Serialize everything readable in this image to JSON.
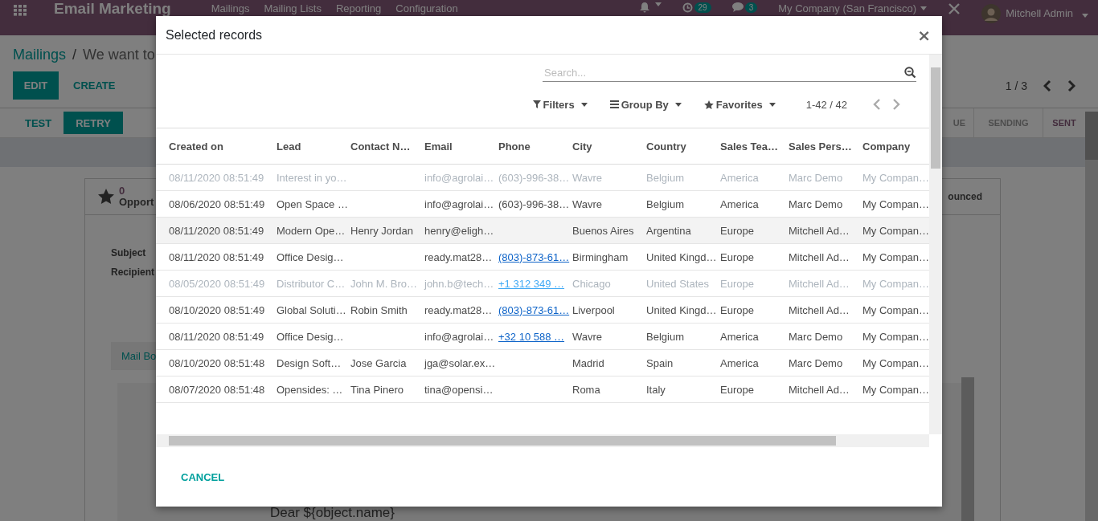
{
  "app": {
    "navbar": {
      "app_name": "Email Marketing",
      "menu": [
        "Mailings",
        "Mailing Lists",
        "Reporting",
        "Configuration"
      ],
      "activity_badge": "29",
      "message_badge": "3",
      "company": "My Company (San Francisco)",
      "user": "Mitchell Admin"
    },
    "breadcrumb": {
      "root": "Mailings",
      "separator": "/",
      "current": "We want to"
    },
    "buttons": [
      "EDIT",
      "CREATE"
    ],
    "pager": "1 / 3",
    "actions": [
      {
        "label": "TEST",
        "primary": false
      },
      {
        "label": "RETRY",
        "primary": true
      }
    ],
    "stages": [
      {
        "label": "UE",
        "selected": false
      },
      {
        "label": "SENDING",
        "selected": false
      },
      {
        "label": "SENT",
        "selected": true
      }
    ],
    "stats": [
      {
        "value": "0",
        "label": "Opport"
      },
      {
        "label": "ounced"
      }
    ],
    "fields": [
      "Subject",
      "Recipient"
    ],
    "tab": "Mail Bo",
    "body_text": "Dear ${object.name}"
  },
  "dialog": {
    "title": "Selected records",
    "close": "×",
    "search": {
      "placeholder": "Search..."
    },
    "filters": [
      {
        "label": "Filters",
        "kind": "filter"
      },
      {
        "label": "Group By",
        "kind": "group"
      },
      {
        "label": "Favorites",
        "kind": "favorite"
      }
    ],
    "pager": "1-42 / 42",
    "columns": [
      "Created on",
      "Lead",
      "Contact N…",
      "Email",
      "Phone",
      "City",
      "Country",
      "Sales Tea…",
      "Sales Pers…",
      "Company"
    ],
    "rows": [
      {
        "muted": true,
        "highlighted": false,
        "cells": [
          "08/11/2020 08:51:49",
          "Interest in yo…",
          "",
          "info@agrolai…",
          "(603)-996-38…",
          "Wavre",
          "Belgium",
          "America",
          "Marc Demo",
          "My Compan…"
        ]
      },
      {
        "muted": false,
        "highlighted": false,
        "cells": [
          "08/06/2020 08:51:49",
          "Open Space …",
          "",
          "info@agrolai…",
          "(603)-996-38…",
          "Wavre",
          "Belgium",
          "America",
          "Marc Demo",
          "My Compan…"
        ]
      },
      {
        "muted": false,
        "highlighted": true,
        "cells": [
          "08/11/2020 08:51:49",
          "Modern Ope…",
          "Henry Jordan",
          "henry@eligh…",
          "",
          "Buenos Aires",
          "Argentina",
          "Europe",
          "Mitchell Ad…",
          "My Compan…"
        ]
      },
      {
        "muted": false,
        "highlighted": false,
        "cells": [
          "08/11/2020 08:51:49",
          "Office Desig…",
          "",
          "ready.mat28…",
          {
            "text": "(803)-873-61…",
            "kind": "link"
          },
          "Birmingham",
          "United Kingd…",
          "Europe",
          "Mitchell Ad…",
          "My Compan…"
        ]
      },
      {
        "muted": true,
        "highlighted": false,
        "cells": [
          "08/05/2020 08:51:49",
          "Distributor C…",
          "John M. Bro…",
          "john.b@tech…",
          {
            "text": "+1 312 349 …",
            "kind": "link"
          },
          "Chicago",
          "United States",
          "Europe",
          "Mitchell Ad…",
          "My Compan…"
        ]
      },
      {
        "muted": false,
        "highlighted": false,
        "cells": [
          "08/10/2020 08:51:49",
          "Global Soluti…",
          "Robin Smith",
          "ready.mat28…",
          {
            "text": "(803)-873-61…",
            "kind": "link"
          },
          "Liverpool",
          "United Kingd…",
          "Europe",
          "Mitchell Ad…",
          "My Compan…"
        ]
      },
      {
        "muted": false,
        "highlighted": false,
        "cells": [
          "08/11/2020 08:51:49",
          "Office Desig…",
          "",
          "info@agrolai…",
          {
            "text": "+32 10 588 …",
            "kind": "link"
          },
          "Wavre",
          "Belgium",
          "America",
          "Marc Demo",
          "My Compan…"
        ]
      },
      {
        "muted": false,
        "highlighted": false,
        "cells": [
          "08/10/2020 08:51:48",
          "Design Soft…",
          "Jose Garcia",
          "jga@solar.ex…",
          "",
          "Madrid",
          "Spain",
          "America",
          "Marc Demo",
          "My Compan…"
        ]
      },
      {
        "muted": false,
        "highlighted": false,
        "cells": [
          "08/07/2020 08:51:48",
          "Opensides: …",
          "Tina Pinero",
          "tina@opensi…",
          "",
          "Roma",
          "Italy",
          "Europe",
          "Mitchell Ad…",
          "My Compan…"
        ]
      }
    ],
    "footer_buttons": [
      "CANCEL"
    ]
  }
}
